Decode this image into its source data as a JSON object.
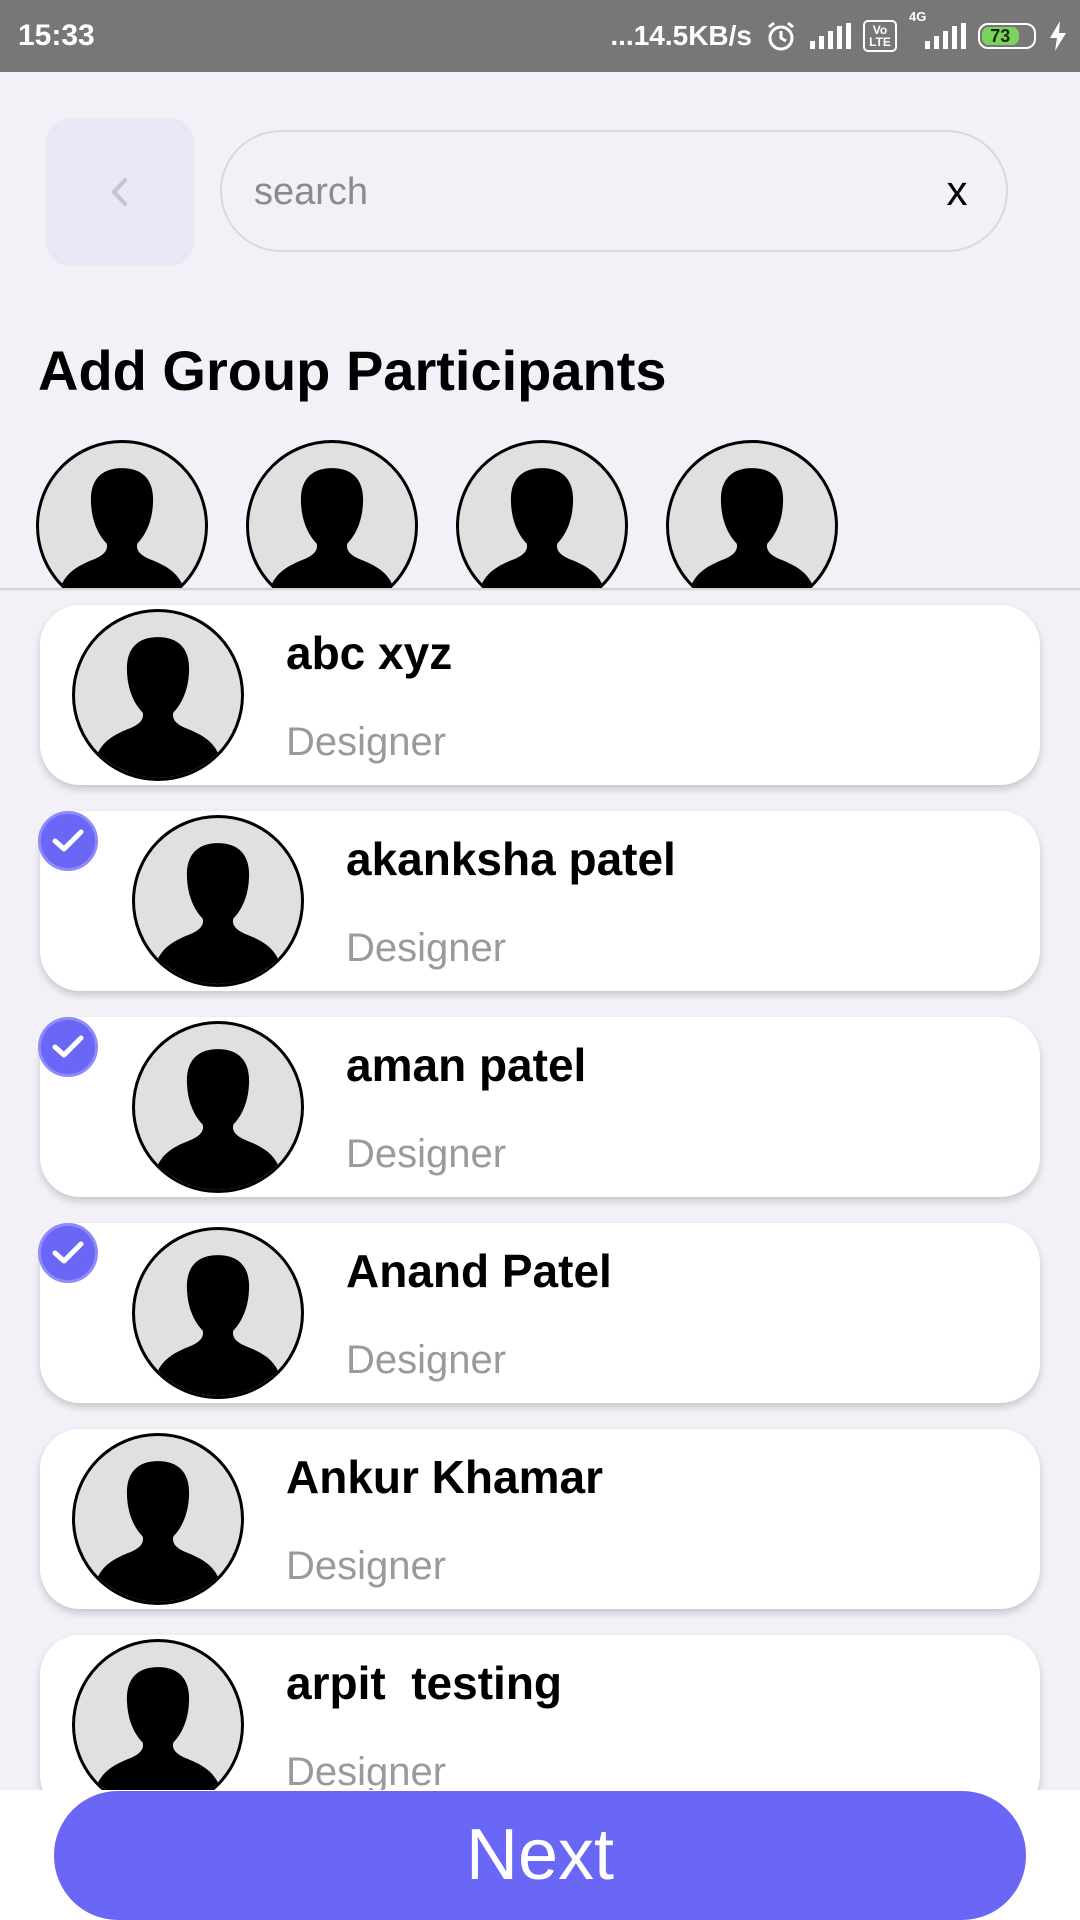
{
  "status_bar": {
    "time": "15:33",
    "network_speed": "...14.5KB/s",
    "network_type": "4G",
    "volte": "Vo LTE",
    "battery": "73",
    "icons": [
      "alarm-icon",
      "signal-icon",
      "volte-icon",
      "signal-4g-icon",
      "battery-icon",
      "charging-icon"
    ]
  },
  "header": {
    "back_icon": "chevron-left-icon",
    "search_placeholder": "search",
    "search_value": "",
    "clear_label": "x"
  },
  "title": "Add Group Participants",
  "selected_participants_count": 4,
  "participants": [
    {
      "name": "abc xyz",
      "role": "Designer",
      "selected": false
    },
    {
      "name": "akanksha patel",
      "role": "Designer",
      "selected": true
    },
    {
      "name": "aman patel",
      "role": "Designer",
      "selected": true
    },
    {
      "name": "Anand Patel",
      "role": "Designer",
      "selected": true
    },
    {
      "name": "Ankur Khamar",
      "role": "Designer",
      "selected": false
    },
    {
      "name": "arpit  testing",
      "role": "Designer",
      "selected": false
    }
  ],
  "next_label": "Next",
  "colors": {
    "accent": "#6a66f6",
    "background": "#f2f1f8",
    "status_bar": "#777777",
    "role_text": "#9a9a9a"
  }
}
